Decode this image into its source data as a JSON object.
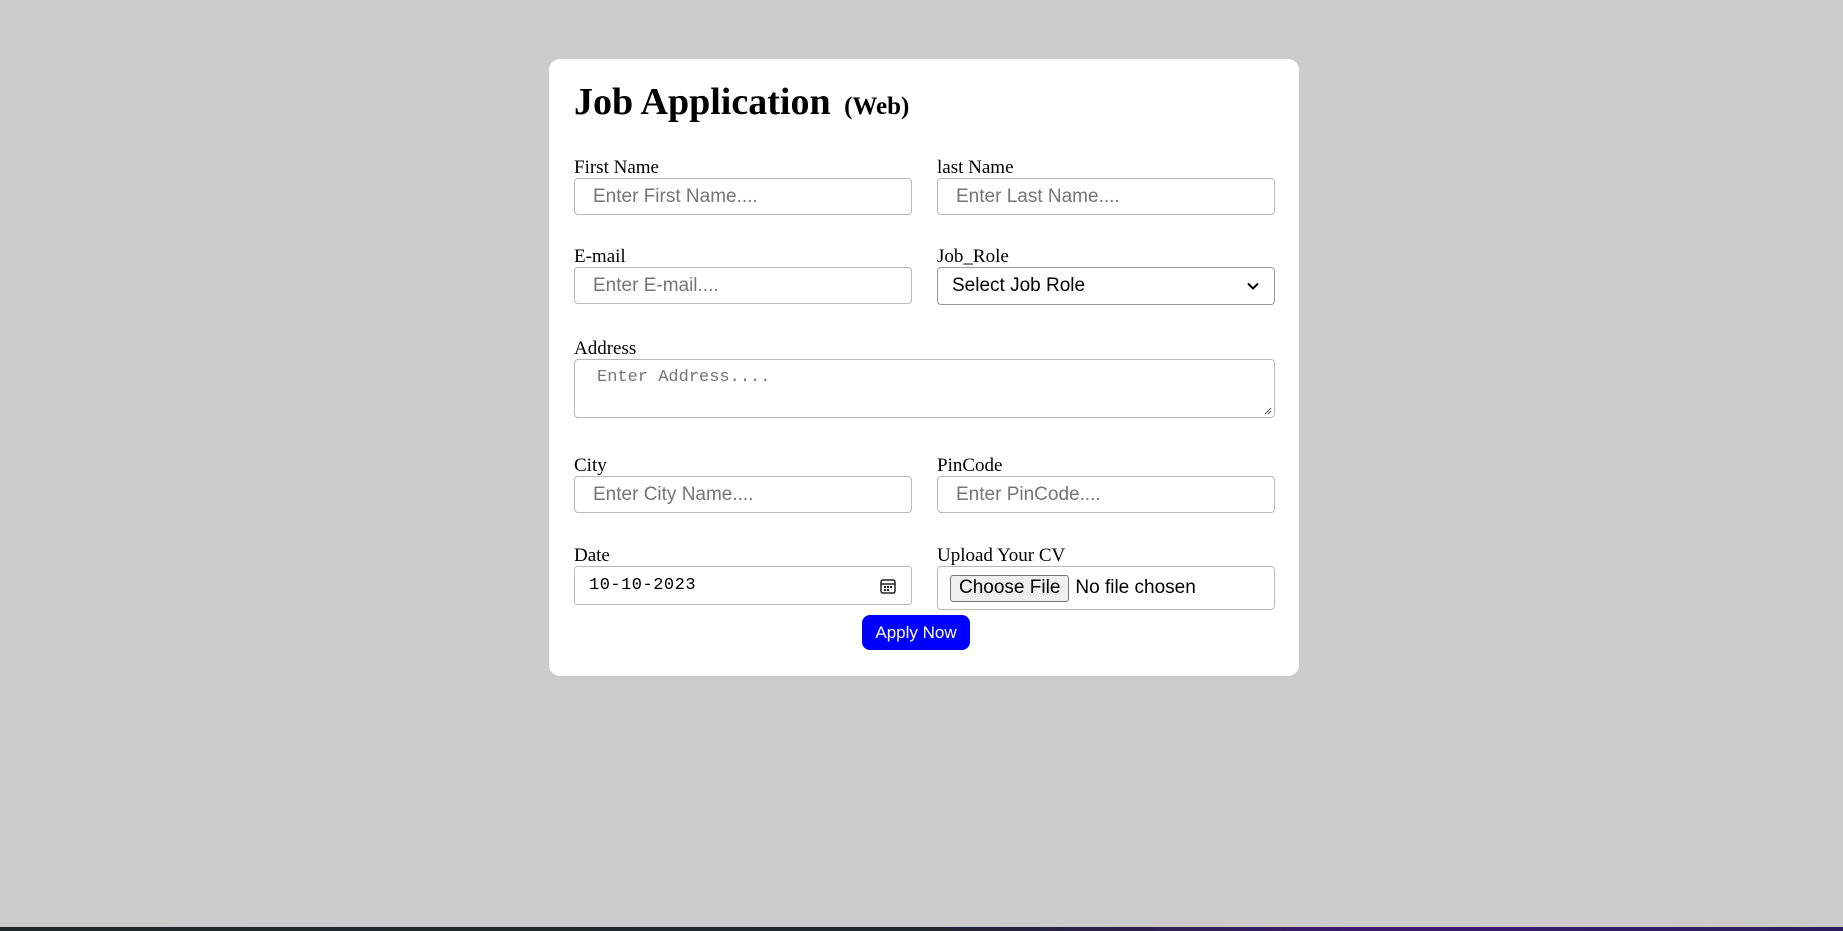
{
  "form": {
    "title": "Job Application",
    "subtitle": "(Web)",
    "first_name": {
      "label": "First Name",
      "placeholder": "Enter First Name...."
    },
    "last_name": {
      "label": "last Name",
      "placeholder": "Enter Last Name...."
    },
    "email": {
      "label": "E-mail",
      "placeholder": "Enter E-mail...."
    },
    "job_role": {
      "label": "Job_Role",
      "selected": "Select Job Role"
    },
    "address": {
      "label": "Address",
      "placeholder": "Enter Address...."
    },
    "city": {
      "label": "City",
      "placeholder": "Enter City Name...."
    },
    "pincode": {
      "label": "PinCode",
      "placeholder": "Enter PinCode...."
    },
    "date": {
      "label": "Date",
      "value": "10-10-2023"
    },
    "cv": {
      "label": "Upload Your CV",
      "button": "Choose File",
      "status": "No file chosen"
    },
    "submit_label": "Apply Now"
  },
  "colors": {
    "page_background": "#cccccc",
    "card_background": "#ffffff",
    "button_background": "#0000ff",
    "button_text": "#ffffff"
  },
  "icons": {
    "select_arrow": "chevron-down-icon",
    "date_picker": "calendar-icon",
    "textarea_resize": "resize-grip-icon"
  }
}
